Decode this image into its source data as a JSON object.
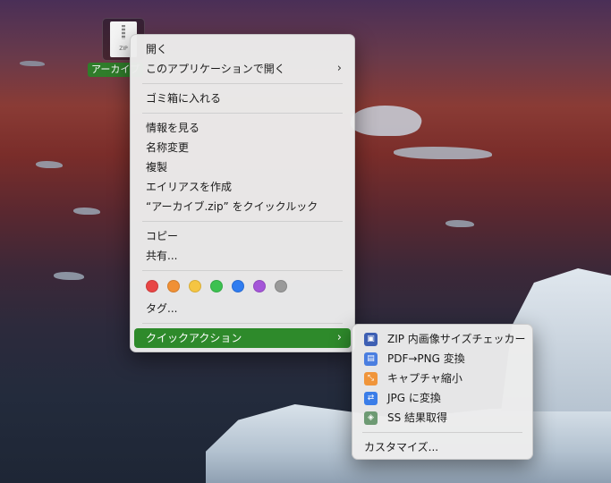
{
  "desktop": {
    "file": {
      "label": "アーカイブ",
      "icon": "zip-archive-icon",
      "icon_text": "ZIP"
    }
  },
  "context_menu": {
    "open": "開く",
    "open_with": "このアプリケーションで開く",
    "move_to_trash": "ゴミ箱に入れる",
    "get_info": "情報を見る",
    "rename": "名称変更",
    "duplicate": "複製",
    "make_alias": "エイリアスを作成",
    "quick_look": "“アーカイブ.zip” をクイックルック",
    "copy": "コピー",
    "share": "共有...",
    "tag_colors": [
      "#e84545",
      "#f09035",
      "#f5c542",
      "#3cc150",
      "#2f7cf0",
      "#a455d8",
      "#9a9a9a"
    ],
    "tags": "タグ...",
    "quick_actions": "クイックアクション",
    "submenu_arrow": "›"
  },
  "quick_actions_menu": {
    "items": [
      {
        "label": "ZIP 内画像サイズチェッカー",
        "icon": "image-icon",
        "color": "#3d5fb3",
        "glyph": "▣"
      },
      {
        "label": "PDF→PNG 変換",
        "icon": "automator-icon",
        "color": "#4a7ee0",
        "glyph": "▤"
      },
      {
        "label": "キャプチャ縮小",
        "icon": "shrink-icon",
        "color": "#f0953a",
        "glyph": "⤡"
      },
      {
        "label": "JPG に変換",
        "icon": "shuffle-icon",
        "color": "#3a7de8",
        "glyph": "⇄"
      },
      {
        "label": "SS 結果取得",
        "icon": "layers-icon",
        "color": "#6d9a73",
        "glyph": "◈"
      }
    ],
    "customize": "カスタマイズ..."
  }
}
